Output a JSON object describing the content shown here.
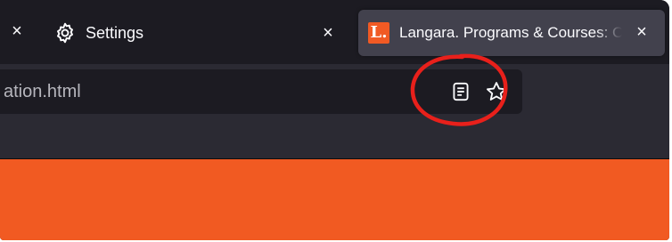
{
  "tabs": {
    "left_close_glyph": "×",
    "settings": {
      "label": "Settings",
      "icon": "gear-icon",
      "close_glyph": "×"
    },
    "active": {
      "favicon_letter": "L.",
      "title": "Langara. Programs & Courses: C",
      "close_glyph": "×",
      "favicon_color": "#f15a24"
    }
  },
  "urlbar": {
    "url_text": "ation.html",
    "reader_view_icon": "reader-view-icon",
    "bookmark_icon": "bookmark-star-icon"
  },
  "page": {
    "background_color": "#f15a22"
  },
  "annotation": {
    "shape": "red-ellipse",
    "color": "#e8201b",
    "target": "reader-view-icon"
  },
  "theme": {
    "tabbar_bg": "#1c1b22",
    "navbar_bg": "#2b2a33",
    "active_tab_bg": "#42414d",
    "text": "#fbfbfe"
  }
}
